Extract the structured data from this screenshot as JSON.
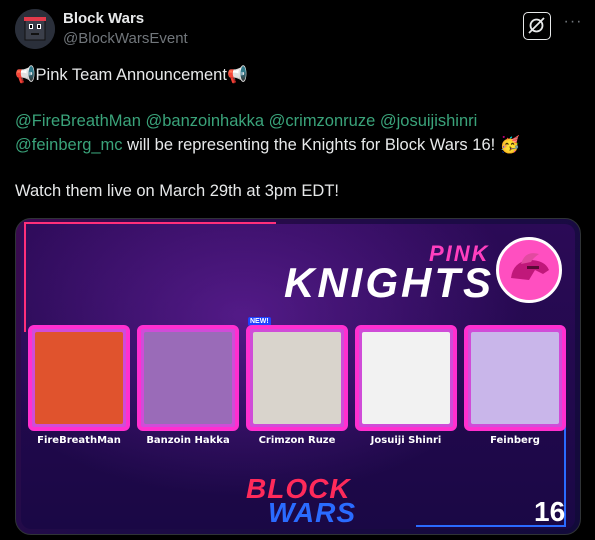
{
  "account": {
    "display_name": "Block Wars",
    "handle": "@BlockWarsEvent"
  },
  "actions": {
    "grok_icon": "grok-icon",
    "more_label": "···"
  },
  "post": {
    "line1": "📢Pink Team Announcement📢",
    "mentions_line1": [
      "@FireBreathMan",
      "@banzoinhakka",
      "@crimzonruze",
      "@josuijishinri"
    ],
    "mention_line2": "@feinberg_mc",
    "line2_rest": " will be representing the Knights for Block Wars 16! 🥳",
    "line3": "Watch them live on March 29th at 3pm EDT!"
  },
  "graphic": {
    "pink": "PINK",
    "knights": "KNIGHTS",
    "new_badge": "NEW!",
    "players": [
      {
        "name": "FireBreathMan",
        "color": "#e0532d"
      },
      {
        "name": "Banzoin Hakka",
        "color": "#9a6bb8"
      },
      {
        "name": "Crimzon Ruze",
        "color": "#d9d4cc"
      },
      {
        "name": "Josuiji Shinri",
        "color": "#f2f2f2"
      },
      {
        "name": "Feinberg",
        "color": "#c9b6ea"
      }
    ],
    "logo_block": "BLOCK",
    "logo_wars": "WARS",
    "edition": "16"
  },
  "colors": {
    "mention": "#3aa37a",
    "card_border": "#ff2fd0",
    "pink_accent": "#ff3fbf",
    "block_red": "#ff2a5a",
    "wars_blue": "#2a6bff"
  }
}
